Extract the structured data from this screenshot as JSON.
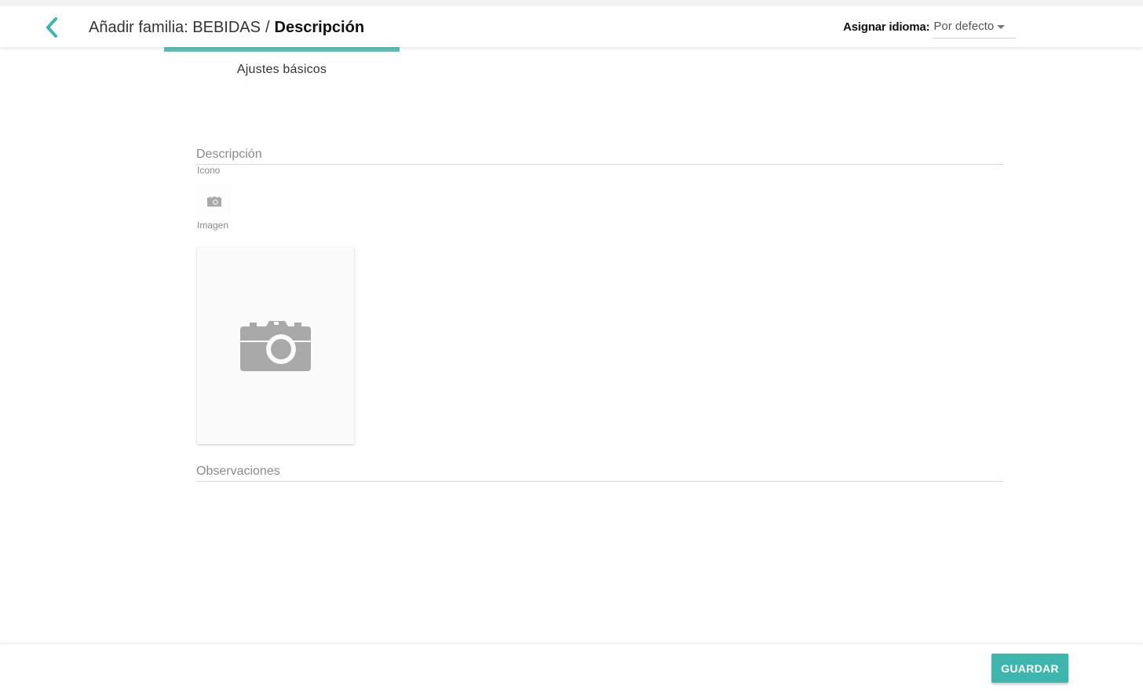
{
  "header": {
    "title_prefix": "Añadir familia: BEBIDAS",
    "separator": "/",
    "title_current": "Descripción",
    "language_label": "Asignar idioma:",
    "language_value": "Por defecto",
    "back_icon": "chevron-left-icon"
  },
  "tabs": [
    {
      "label": "Ajustes básicos",
      "active": true
    }
  ],
  "form": {
    "description_placeholder": "Descripción",
    "icon_label": "Icono",
    "image_label": "Imagen",
    "observations_placeholder": "Observaciones"
  },
  "footer": {
    "save_label": "GUARDAR"
  },
  "colors": {
    "accent": "#3fb6ad",
    "tab_indicator": "#5ec0b8",
    "placeholder_icon": "#a9a9a9"
  }
}
